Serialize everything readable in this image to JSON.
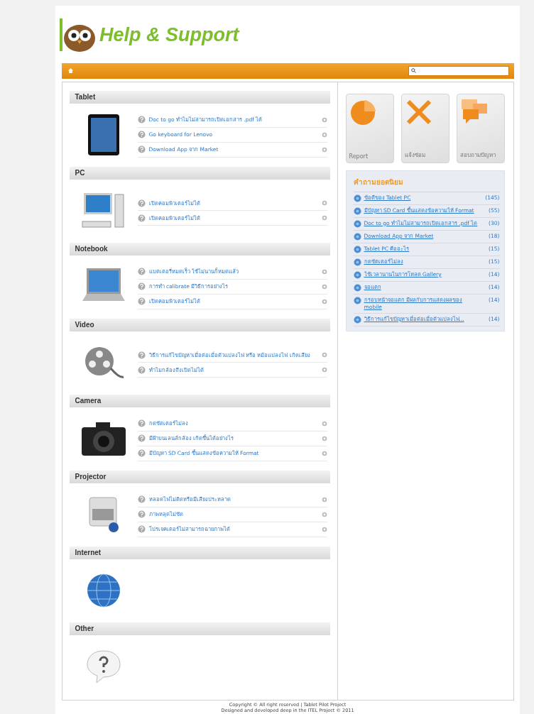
{
  "header": {
    "title": "Help & Support"
  },
  "categories": [
    {
      "title": "Tablet",
      "kind": "tablet",
      "items": [
        "Doc to go ทำไมไม่สามารถเปิดเอกสาร .pdf ได้",
        "Go keyboard for Lenovo",
        "Download App จาก Market"
      ]
    },
    {
      "title": "PC",
      "kind": "pc",
      "items": [
        "เปิดคอมพิวเตอร์ไม่ได้",
        "เปิดคอมพิวเตอร์ไม่ได้"
      ]
    },
    {
      "title": "Notebook",
      "kind": "notebook",
      "items": [
        "แบตเตอรี่หมดเร็ว ใช้ไม่นานก็หมดแล้ว",
        "การทำ calibrate มีวิธีการอย่างไร",
        "เปิดคอมพิวเตอร์ไม่ได้"
      ]
    },
    {
      "title": "Video",
      "kind": "video",
      "items": [
        "วิธีการแก้ไขปัญหาเมื่อต่อเมื่อตัวแปลงไฟ หรือ หม้อแปลงไฟ เกิดเสียง",
        "ทำไมกล้องถึงเปิดไม่ได้"
      ]
    },
    {
      "title": "Camera",
      "kind": "camera",
      "items": [
        "กดชัตเตอร์ไม่ลง",
        "มีฝ้าบนเลนส์กล้อง เกิดขึ้นได้อย่างไร",
        "มีปัญหา SD Card ขึ้นแสดงข้อความให้ Format"
      ]
    },
    {
      "title": "Projector",
      "kind": "projector",
      "items": [
        "หลอดไฟไม่ติดหรือมีเสียงประหลาด",
        "ภาพหลุดไม่ชัด",
        "โปรเจคเตอร์ไม่สามารถฉายภาพได้"
      ]
    },
    {
      "title": "Internet",
      "kind": "internet"
    },
    {
      "title": "Other",
      "kind": "other"
    }
  ],
  "tiles": [
    {
      "label": "Report",
      "kind": "report"
    },
    {
      "label": "แจ้งซ่อม",
      "kind": "repair"
    },
    {
      "label": "สอบถามปัญหา",
      "kind": "ask"
    }
  ],
  "popular": {
    "title": "คำถามยอดนิยม",
    "items": [
      {
        "text": "ข้อดีของ Tablet PC",
        "count": "(145)"
      },
      {
        "text": "มีปัญหา SD Card ขึ้นแสดงข้อความให้ Format",
        "count": "(55)"
      },
      {
        "text": "Doc to go ทำไมไม่สามารถเปิดเอกสาร .pdf ได",
        "count": "(30)"
      },
      {
        "text": "Download App จาก Market",
        "count": "(18)"
      },
      {
        "text": "Tablet PC คืออะไร",
        "count": "(15)"
      },
      {
        "text": "กดชัตเตอร์ไม่ลง",
        "count": "(15)"
      },
      {
        "text": "ใช้เวลานานในการโหลด Gallery",
        "count": "(14)"
      },
      {
        "text": "จอแตก",
        "count": "(14)"
      },
      {
        "text": "กรอบหน้าจอแตก มีผลกับการแสดงผลของ mobile",
        "count": "(14)"
      },
      {
        "text": "วิธีการแก้ไขปัญหาเมื่อต่อเมื่อตัวแปลงไฟ...",
        "count": "(14)"
      }
    ]
  },
  "footer": [
    "Copyright © All right reserved | Tablet Pilot Project",
    "Designed and developed deep in the ITEL Project © 2011"
  ]
}
